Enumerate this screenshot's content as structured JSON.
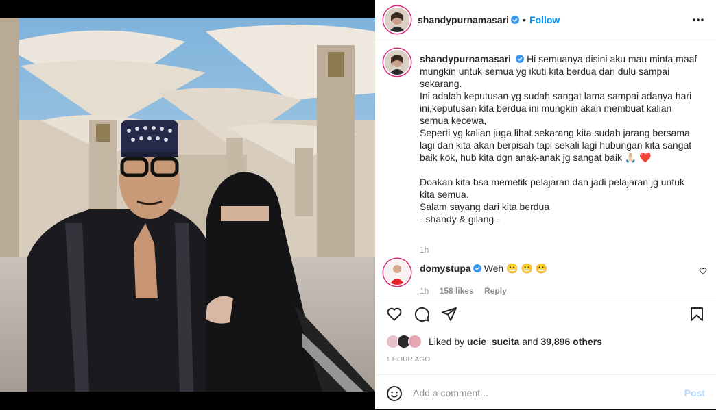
{
  "post": {
    "author": "shandypurnamasari",
    "verified": true,
    "follow_label": "Follow",
    "dot": "•",
    "caption": "Hi semuanya disini aku mau minta maaf mungkin untuk semua yg ikuti kita berdua dari dulu sampai sekarang.\nIni adalah keputusan yg sudah sangat lama sampai adanya hari ini,keputusan kita berdua ini mungkin akan membuat kalian semua kecewa,\nSeperti yg kalian juga lihat sekarang kita sudah jarang bersama lagi dan kita akan berpisah tapi sekali lagi hubungan kita sangat baik kok, hub kita dgn anak-anak jg sangat baik 🙏🏻 ❤️\n\nDoakan kita bsa memetik pelajaran dan jadi pelajaran jg untuk kita semua.\nSalam sayang dari kita berdua\n- shandy & gilang -",
    "caption_time": "1h",
    "liked_by_prefix": "Liked by",
    "liked_by_user": "ucie_sucita",
    "liked_by_and": "and",
    "liked_by_others": "39,896 others",
    "timestamp": "1 HOUR AGO"
  },
  "comment": {
    "author": "domystupa",
    "verified": true,
    "text": "Weh",
    "emojis": [
      "😬",
      "😬",
      "😬"
    ],
    "time": "1h",
    "likes": "158 likes",
    "reply": "Reply"
  },
  "composer": {
    "placeholder": "Add a comment...",
    "post_label": "Post"
  },
  "colors": {
    "accent": "#0095f6",
    "post_disabled": "#b3dbff",
    "story_ring": "#d62976"
  },
  "icons": [
    "more-icon",
    "heart-icon",
    "comment-icon",
    "share-icon",
    "bookmark-icon",
    "emoji-icon",
    "verified-icon"
  ]
}
